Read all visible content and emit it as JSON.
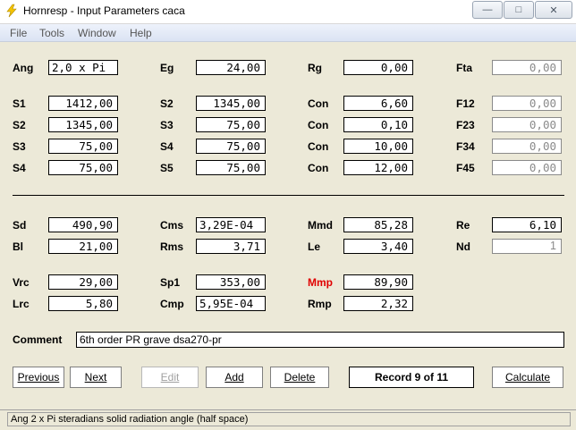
{
  "window": {
    "title": "Hornresp - Input Parameters   caca",
    "buttons": {
      "minimize": "—",
      "maximize": "□",
      "close": "✕"
    }
  },
  "menu": [
    "File",
    "Tools",
    "Window",
    "Help"
  ],
  "params": {
    "ang": {
      "label": "Ang",
      "value": "2,0 x Pi"
    },
    "eg": {
      "label": "Eg",
      "value": "24,00"
    },
    "rg": {
      "label": "Rg",
      "value": "0,00"
    },
    "fta": {
      "label": "Fta",
      "value": "0,00"
    },
    "col1": [
      {
        "label": "S1",
        "value": "1412,00"
      },
      {
        "label": "S2",
        "value": "1345,00"
      },
      {
        "label": "S3",
        "value": "75,00"
      },
      {
        "label": "S4",
        "value": "75,00"
      }
    ],
    "col2": [
      {
        "label": "S2",
        "value": "1345,00"
      },
      {
        "label": "S3",
        "value": "75,00"
      },
      {
        "label": "S4",
        "value": "75,00"
      },
      {
        "label": "S5",
        "value": "75,00"
      }
    ],
    "col3": [
      {
        "label": "Con",
        "value": "6,60"
      },
      {
        "label": "Con",
        "value": "0,10"
      },
      {
        "label": "Con",
        "value": "10,00"
      },
      {
        "label": "Con",
        "value": "12,00"
      }
    ],
    "col4": [
      {
        "label": "F12",
        "value": "0,00"
      },
      {
        "label": "F23",
        "value": "0,00"
      },
      {
        "label": "F34",
        "value": "0,00"
      },
      {
        "label": "F45",
        "value": "0,00"
      }
    ],
    "sd": {
      "label": "Sd",
      "value": "490,90"
    },
    "cms": {
      "label": "Cms",
      "value": "3,29E-04"
    },
    "mmd": {
      "label": "Mmd",
      "value": "85,28"
    },
    "re": {
      "label": "Re",
      "value": "6,10"
    },
    "bl": {
      "label": "Bl",
      "value": "21,00"
    },
    "rms": {
      "label": "Rms",
      "value": "3,71"
    },
    "le": {
      "label": "Le",
      "value": "3,40"
    },
    "nd": {
      "label": "Nd",
      "value": "1"
    },
    "vrc": {
      "label": "Vrc",
      "value": "29,00"
    },
    "sp1": {
      "label": "Sp1",
      "value": "353,00"
    },
    "mmp": {
      "label": "Mmp",
      "value": "89,90",
      "label_color": "#e00000"
    },
    "lrc": {
      "label": "Lrc",
      "value": "5,80"
    },
    "cmp": {
      "label": "Cmp",
      "value": "5,95E-04"
    },
    "rmp": {
      "label": "Rmp",
      "value": "2,32"
    }
  },
  "comment": {
    "label": "Comment",
    "value": "6th order PR grave dsa270-pr"
  },
  "buttons": {
    "previous": "Previous",
    "next": "Next",
    "edit": "Edit",
    "add": "Add",
    "delete": "Delete",
    "record": "Record 9 of 11",
    "calculate": "Calculate"
  },
  "status": "Ang    2 x Pi steradians solid radiation angle  (half space)"
}
